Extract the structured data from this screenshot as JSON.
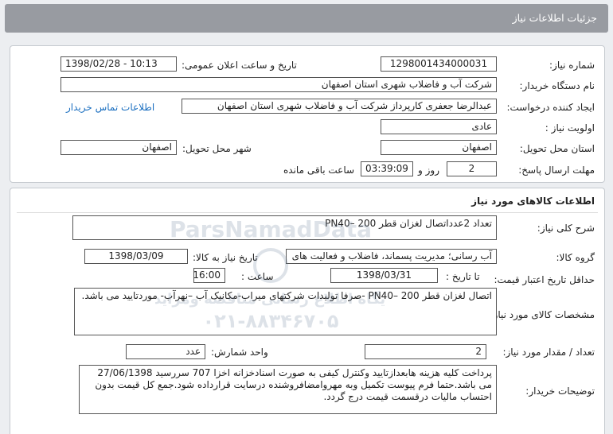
{
  "header": {
    "title": "جزئیات اطلاعات نیاز"
  },
  "need_info": {
    "need_number_label": "شماره نیاز:",
    "need_number": "1298001434000031",
    "announce_label": "تاریخ و ساعت اعلان عمومی:",
    "announce_value": "1398/02/28 - 10:13",
    "buyer_org_label": "نام دستگاه خریدار:",
    "buyer_org": "شرکت آب و فاضلاب شهری استان اصفهان",
    "requester_label": "ایجاد کننده درخواست:",
    "requester": "عبدالرضا جعفری کارپرداز شرکت آب و فاضلاب شهری استان اصفهان",
    "contact_link": "اطلاعات تماس خریدار",
    "priority_label": "اولویت نیاز :",
    "priority": "عادی",
    "province_label": "استان محل تحویل:",
    "province": "اصفهان",
    "city_label": "شهر محل تحویل:",
    "city": "اصفهان",
    "deadline_label": "مهلت ارسال پاسخ:",
    "days": "2",
    "days_word": "روز و",
    "time_left": "03:39:09",
    "time_left_suffix": "ساعت باقی مانده"
  },
  "goods": {
    "section_title": "اطلاعات کالاهای مورد نیاز",
    "summary_label": "شرح کلی نیاز:",
    "summary": "تعداد 2عدداتصال لغزان قطر  200  –PN40",
    "group_label": "گروه کالا:",
    "group": "آب رسانی؛ مدیریت پسماند، فاضلاب و فعالیت های",
    "need_date_label": "تاریخ نیاز به کالا:",
    "need_date": "1398/03/09",
    "validity_label": "حداقل تاریخ اعتبار قیمت:",
    "to_date_label": "تا تاریخ :",
    "to_date": "1398/03/31",
    "time_label": "ساعت :",
    "time": "16:00",
    "spec_label": "مشخصات کالای مورد نیاز:",
    "spec": "اتصال لغزان قطر  200  –PN40 -صرفا تولیدات  شرکتهای میراب-مکانیک آب –نهرآب- موردتایید می باشد.",
    "qty_label": "تعداد / مقدار مورد نیاز:",
    "qty": "2",
    "unit_label": "واحد شمارش:",
    "unit": "عدد",
    "notes_label": "توضیحات خریدار:",
    "notes": "پرداخت کلیه هزینه هابعدازتایید وکنترل کیفی به صورت اسنادخزانه اخزا 707 سررسید 27/06/1398 می باشد.حتما فرم پیوست تکمیل وبه مهروامضافروشنده درسایت قرارداده شود.جمع کل قیمت بدون احتساب مالیات درقسمت قیمت درج گردد."
  },
  "watermark": {
    "line1": "پایگاه اطلاع رسانی مناقصه ومزایده",
    "line2": "۰۲۱-۸۸۳۴۶۷۰۵",
    "brand": "ParsNamadData"
  }
}
